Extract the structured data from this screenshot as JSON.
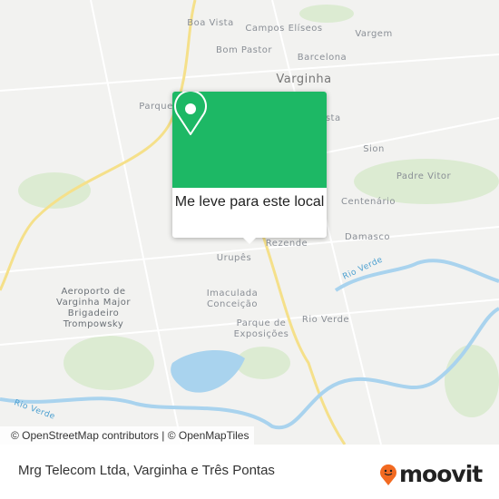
{
  "map": {
    "labels": {
      "boa_vista": "Boa Vista",
      "campos_eliseos": "Campos Elíseos",
      "vargem": "Vargem",
      "bom_pastor": "Bom Pastor",
      "barcelona": "Barcelona",
      "varginha": "Varginha",
      "parque": "Parque",
      "vista": "Vista",
      "sion": "Sion",
      "padre_vitor": "Padre Vitor",
      "centenario": "Centenário",
      "damasco": "Damasco",
      "rezende": "Rezende",
      "urupes": "Urupês",
      "imaculada": "Imaculada Conceição",
      "parque_exposicoes": "Parque de Exposições",
      "rio_verde_district": "Rio Verde",
      "airport": "Aeroporto de Varginha Major Brigadeiro Trompowsky",
      "river_1": "Rio Verde",
      "river_2": "Rio Verde"
    },
    "attribution": "© OpenStreetMap contributors | © OpenMapTiles"
  },
  "popup": {
    "label": "Me leve para este local",
    "icon": "map-pin-icon",
    "color": "#1db865"
  },
  "footer": {
    "title": "Mrg Telecom Ltda, Varginha e Três Pontas",
    "logo_text": "moovit",
    "logo_color": "#f26a21"
  }
}
